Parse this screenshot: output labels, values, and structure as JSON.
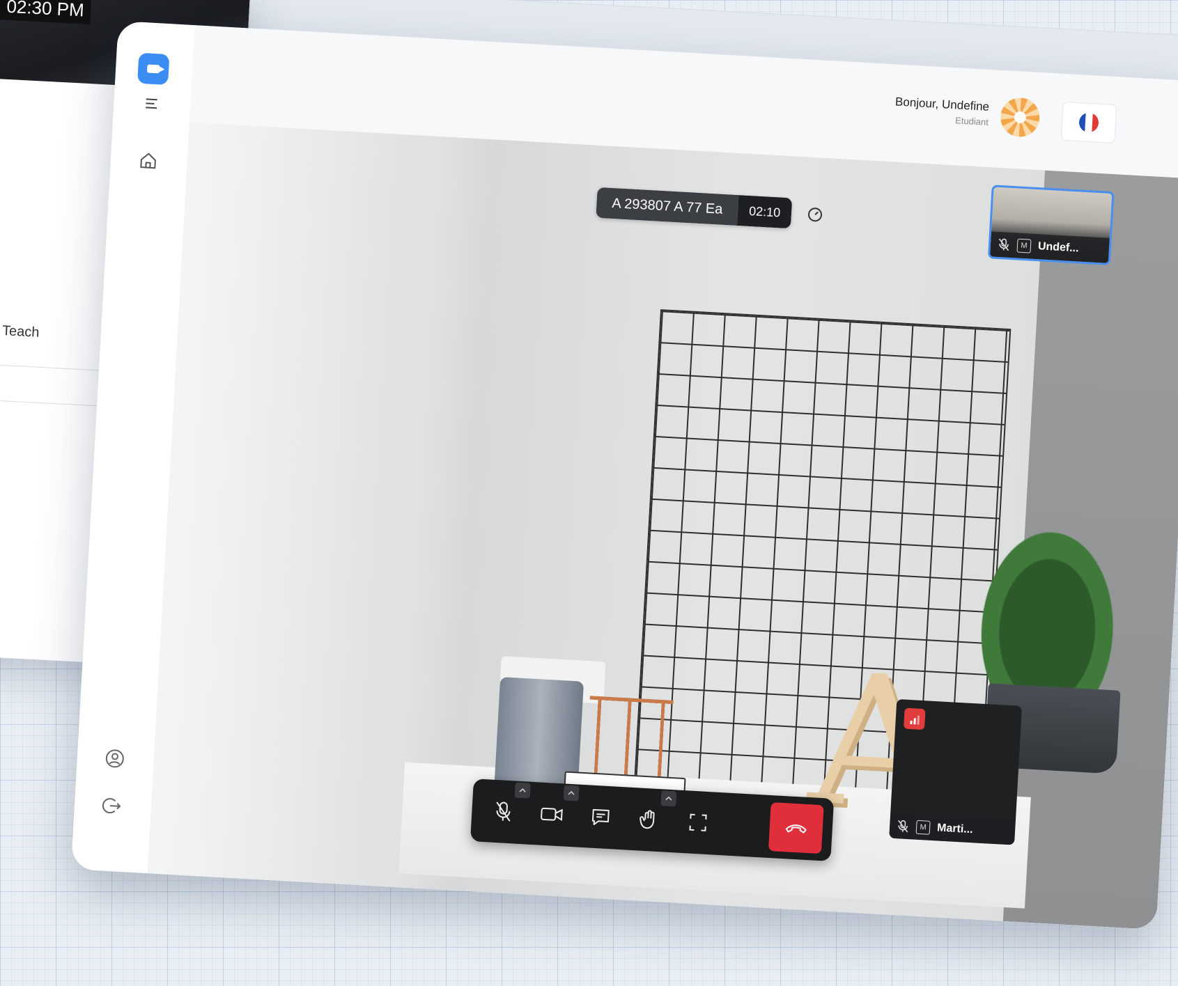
{
  "background_window": {
    "time": "02:30 PM",
    "label": "Teach"
  },
  "header": {
    "greeting": "Bonjour, Undefine",
    "role": "Etudiant",
    "language_flag": "france-flag-icon"
  },
  "sidebar": {
    "items": [
      {
        "name": "menu",
        "icon": "hamburger-icon"
      },
      {
        "name": "home",
        "icon": "home-icon"
      },
      {
        "name": "profile",
        "icon": "user-circle-icon"
      },
      {
        "name": "logout",
        "icon": "logout-icon"
      }
    ]
  },
  "meeting": {
    "room_id": "A 293807 A 77 Ea",
    "timer": "02:10",
    "participants": [
      {
        "name": "Undef...",
        "badge": "M",
        "muted": true
      },
      {
        "name": "Marti...",
        "badge": "M",
        "muted": true
      }
    ]
  },
  "controls": [
    "mic-off-icon",
    "camera-icon",
    "chat-icon",
    "raise-hand-icon",
    "fullscreen-icon",
    "hangup-icon"
  ],
  "colors": {
    "brand": "#3c8df3",
    "hangup": "#e02f3b",
    "active_tile_border": "#4a8ff0",
    "signal_warning": "#e23d3d"
  }
}
